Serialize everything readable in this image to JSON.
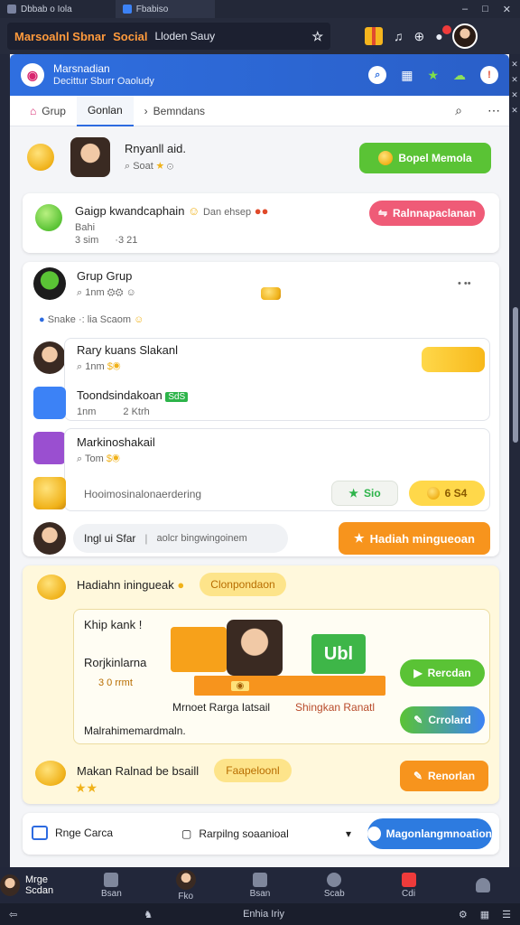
{
  "os": {
    "tab1": "Dbbab o Iola",
    "tab2": "Fbabiso",
    "controls": [
      "–",
      "□",
      "✕"
    ]
  },
  "app": {
    "title_orange": "Marsoalnl Sbnar",
    "title_social": "Social",
    "title_sub": "Lloden Sauy"
  },
  "brand": {
    "line1": "Marsnadian",
    "line2": "Decittur Sburr Oaoludy"
  },
  "tabs": [
    {
      "label": "Grup"
    },
    {
      "label": "Gonlan"
    },
    {
      "label": "Bemndans"
    }
  ],
  "profile_card": {
    "name": "Rnyanll aid.",
    "meta": "Soat",
    "button": "Bopel Memola"
  },
  "invite_card": {
    "title": "Gaigp kwandcaphain",
    "meta_a": "Bahi",
    "meta_b": "3 sim",
    "meta_c": "·3 21",
    "suffix": "Dan ehsep",
    "button": "Ralnnapaclanan"
  },
  "group_card": {
    "title": "Grup Grup",
    "meta": "1nm",
    "more": "• ••",
    "sub": "Snake ·: lia Scaom"
  },
  "members": [
    {
      "name": "Rary kuans Slakanl",
      "meta": "1nm"
    },
    {
      "name": "Toondsindakoan",
      "badge": "SdS",
      "meta_a": "1nm",
      "meta_b": "2 Ktrh"
    },
    {
      "name": "Markinoshakail",
      "meta": "Tom"
    },
    {
      "name": "Hooimosinalonaerdering",
      "tag": "Sio",
      "coins": "6 S4"
    }
  ],
  "chat_row": {
    "text": "Ingl ui Sfar",
    "placeholder": "aolcr bingwingoinem",
    "button": "Hadiah mingueoan"
  },
  "reward_section": {
    "title": "Hadiahn iningueak",
    "tag": "Clonpondaon",
    "inner_title": "Khip kank !",
    "inner_label": "Rorjkinlarna",
    "inner_points": "3 0 rrmt",
    "footer": "Malrahimemardmaln.",
    "gift_label": "Ubl",
    "caption_a": "Mrnoet Rarga Iatsail",
    "caption_b": "Shingkan Ranatl",
    "btn_a": "Rercdan",
    "btn_b": "Crrolard",
    "row_title": "Makan Ralnad be bsaill",
    "row_tag": "Faapeloonl",
    "row_button": "Renorlan"
  },
  "footer_bar": {
    "label": "Rnge Carca",
    "select": "Rarpilng soaanioal",
    "button": "Magonlangmnoation"
  },
  "bottom_nav": {
    "user": "Mrge Scdan",
    "items": [
      "Bsan",
      "Fko",
      "Bsan",
      "Scab",
      "Cdi"
    ]
  },
  "os_bottom": {
    "center": "Enhia Iriy"
  },
  "colors": {
    "accent_blue": "#2f6fe0",
    "green": "#5ac335",
    "orange": "#f7941d",
    "pink": "#ef5b77"
  }
}
